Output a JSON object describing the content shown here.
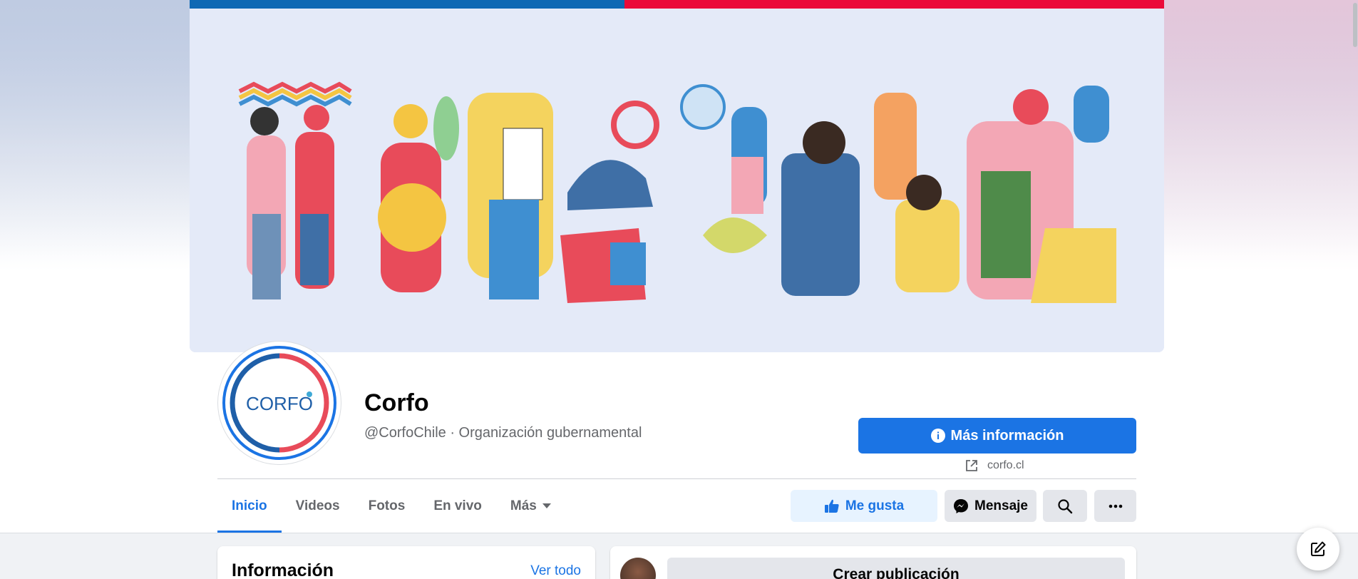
{
  "page": {
    "name": "Corfo",
    "subtitle": "@CorfoChile · Organización gubernamental",
    "logo_text": "CORFO"
  },
  "actions": {
    "more_info_label": "Más información",
    "website": "corfo.cl",
    "like_label": "Me gusta",
    "message_label": "Mensaje"
  },
  "tabs": [
    {
      "label": "Inicio",
      "active": true
    },
    {
      "label": "Videos"
    },
    {
      "label": "Fotos"
    },
    {
      "label": "En vivo"
    },
    {
      "label": "Más"
    }
  ],
  "cards": {
    "info_title": "Información",
    "info_link": "Ver todo",
    "create_post": "Crear publicación"
  },
  "colors": {
    "accent": "#1b74e4",
    "flag_blue": "#0f69b4",
    "flag_red": "#eb0a39"
  },
  "icons": [
    "info-icon",
    "external-link-icon",
    "thumbs-up-icon",
    "messenger-icon",
    "search-icon",
    "more-dots-icon",
    "compose-icon",
    "caret-down-icon"
  ]
}
